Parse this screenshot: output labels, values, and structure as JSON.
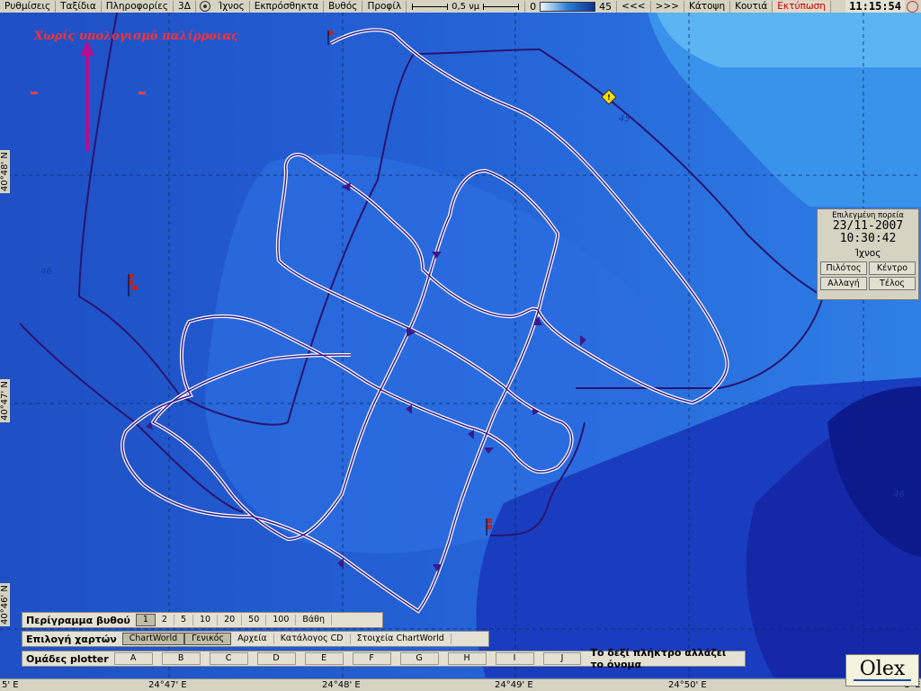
{
  "menubar": {
    "items": [
      "Ρυθμίσεις",
      "Ταξίδια",
      "Πληροφορίες",
      "3Δ"
    ],
    "items2": [
      "Ίχνος",
      "Εκπρόσθηκτα",
      "Βυθός",
      "Προφίλ"
    ],
    "scale_label": "0,5 νμ",
    "depth_min": "0",
    "depth_max": "45",
    "nav": [
      "<<<",
      ">>>"
    ],
    "items3": [
      "Κάτοψη",
      "Κουτιά",
      "Εκτύπωση"
    ],
    "clock": "11:15:54"
  },
  "map": {
    "tide_label": "Χωρίς υπολογισμό παλίρροιας",
    "lat_labels": [
      "40°48' N",
      "40°47' N",
      "40°46' N"
    ],
    "lon_labels": [
      "24°47' E",
      "24°48' E",
      "24°49' E",
      "24°50' E"
    ],
    "edge_labels": [
      "5' E",
      "1' E"
    ],
    "depth_soundings": [
      "45",
      "46",
      "46"
    ],
    "colors": {
      "deep": "#1a3ec0",
      "mid": "#2a6fe0",
      "shallow": "#4aa0f0",
      "track": "#ffffff",
      "route": "#3a1a8a"
    }
  },
  "side_panel": {
    "caption": "Επιλεγμένη πορεία",
    "date": "23/11-2007",
    "time": "10:30:42",
    "track": "Ίχνος",
    "buttons": [
      "Πιλότος",
      "Κέντρο",
      "Αλλαγή",
      "Τέλος"
    ]
  },
  "depth_contour_row": {
    "label": "Περίγραμμα βυθού",
    "options": [
      "1",
      "2",
      "5",
      "10",
      "20",
      "50",
      "100",
      "Βάθη"
    ],
    "selected": "1"
  },
  "chart_row": {
    "label": "Επιλογή χαρτών",
    "options": [
      "ChartWorld",
      "Γενικός",
      "Αρχεία",
      "Κατάλογος CD",
      "Στοιχεία ChartWorld"
    ],
    "selected": [
      "ChartWorld",
      "Γενικός"
    ]
  },
  "plotter_row": {
    "label": "Ομάδες plotter",
    "options": [
      "A",
      "B",
      "C",
      "D",
      "E",
      "F",
      "G",
      "H",
      "I",
      "J"
    ],
    "hint": "Το δεξί πλήκτρο αλλάζει το όνομα"
  },
  "brand": "Olex"
}
